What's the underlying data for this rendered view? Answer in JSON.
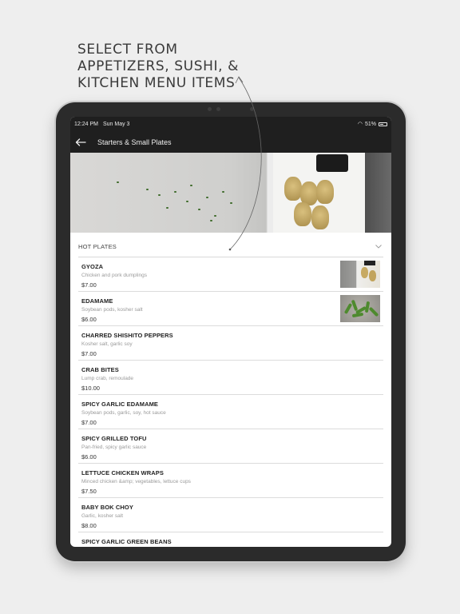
{
  "headline": {
    "lines": [
      "SELECT FROM",
      "APPETIZERS, SUSHI, &",
      "KITCHEN MENU ITEMS"
    ]
  },
  "statusbar": {
    "time": "12:24 PM",
    "date": "Sun May 3",
    "battery": "51%"
  },
  "navbar": {
    "title": "Starters & Small Plates",
    "back_icon": "arrow-left-icon"
  },
  "category": {
    "label": "HOT PLATES",
    "icon": "chevron-down-icon"
  },
  "menu": {
    "items": [
      {
        "name": "GYOZA",
        "desc": "Chicken and pork dumplings",
        "price": "$7.00",
        "thumb": "gyoza"
      },
      {
        "name": "EDAMAME",
        "desc": "Soybean pods, kosher salt",
        "price": "$6.00",
        "thumb": "edamame"
      },
      {
        "name": "CHARRED SHISHITO PEPPERS",
        "desc": "Kosher salt, garlic soy",
        "price": "$7.00"
      },
      {
        "name": "CRAB BITES",
        "desc": "Lump crab, remoulade",
        "price": "$10.00"
      },
      {
        "name": "SPICY GARLIC EDAMAME",
        "desc": "Soybean pods, garlic, soy, hot sauce",
        "price": "$7.00"
      },
      {
        "name": "SPICY GRILLED TOFU",
        "desc": "Pan-fried, spicy garlic sauce",
        "price": "$6.00"
      },
      {
        "name": "LETTUCE CHICKEN WRAPS",
        "desc": "Minced chicken &amp; vegetables, lettuce cups",
        "price": "$7.50"
      },
      {
        "name": "BABY BOK CHOY",
        "desc": "Garlic, kosher salt",
        "price": "$8.00"
      },
      {
        "name": "SPICY GARLIC GREEN BEANS",
        "desc": "",
        "price": ""
      }
    ]
  },
  "colors": {
    "background": "#eeeeee",
    "device": "#2b2b2b",
    "bar": "#1f1f1f"
  }
}
